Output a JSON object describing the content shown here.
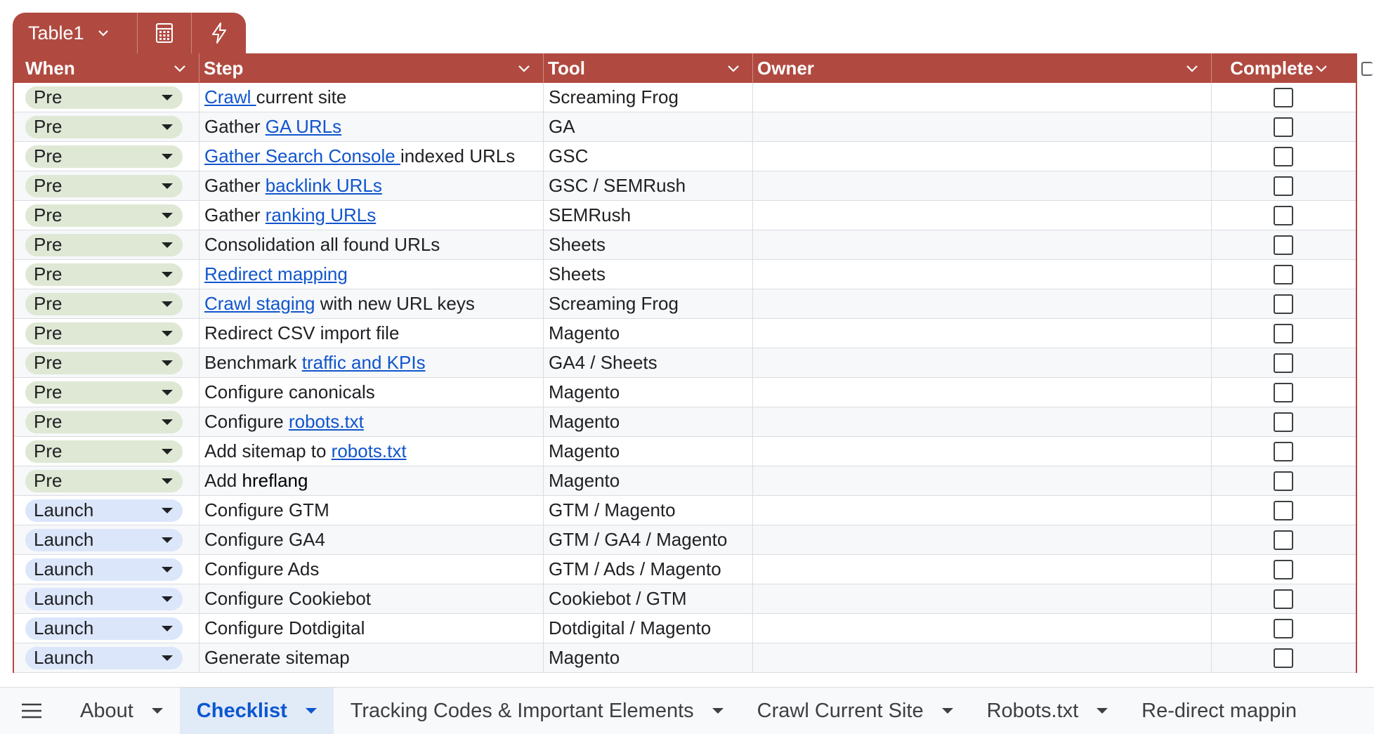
{
  "table": {
    "name": "Table1",
    "columns": [
      "When",
      "Step",
      "Tool",
      "Owner",
      "Complete"
    ],
    "rows": [
      {
        "when": "Pre",
        "step": [
          {
            "t": "Crawl ",
            "l": true
          },
          {
            "t": "current site"
          }
        ],
        "tool": "Screaming Frog"
      },
      {
        "when": "Pre",
        "step": [
          {
            "t": "Gather "
          },
          {
            "t": "GA URLs",
            "l": true
          }
        ],
        "tool": "GA"
      },
      {
        "when": "Pre",
        "step": [
          {
            "t": "Gather Search Console ",
            "l": true
          },
          {
            "t": "indexed URLs"
          }
        ],
        "tool": "GSC"
      },
      {
        "when": "Pre",
        "step": [
          {
            "t": "Gather "
          },
          {
            "t": "backlink URLs",
            "l": true
          }
        ],
        "tool": "GSC / SEMRush"
      },
      {
        "when": "Pre",
        "step": [
          {
            "t": "Gather "
          },
          {
            "t": "ranking URLs",
            "l": true
          }
        ],
        "tool": "SEMRush"
      },
      {
        "when": "Pre",
        "step": [
          {
            "t": "Consolidation all found URLs"
          }
        ],
        "tool": "Sheets"
      },
      {
        "when": "Pre",
        "step": [
          {
            "t": "Redirect mapping",
            "l": true
          }
        ],
        "tool": "Sheets"
      },
      {
        "when": "Pre",
        "step": [
          {
            "t": "Crawl staging",
            "l": true
          },
          {
            "t": " with new URL keys"
          }
        ],
        "tool": "Screaming Frog"
      },
      {
        "when": "Pre",
        "step": [
          {
            "t": "Redirect CSV import file"
          }
        ],
        "tool": "Magento"
      },
      {
        "when": "Pre",
        "step": [
          {
            "t": "Benchmark "
          },
          {
            "t": "traffic and KPIs",
            "l": true
          }
        ],
        "tool": "GA4 / Sheets"
      },
      {
        "when": "Pre",
        "step": [
          {
            "t": "Configure canonicals"
          }
        ],
        "tool": "Magento"
      },
      {
        "when": "Pre",
        "step": [
          {
            "t": "Configure "
          },
          {
            "t": "robots.txt",
            "l": true
          }
        ],
        "tool": "Magento"
      },
      {
        "when": "Pre",
        "step": [
          {
            "t": "Add sitemap to "
          },
          {
            "t": "robots.txt",
            "l": true
          }
        ],
        "tool": "Magento"
      },
      {
        "when": "Pre",
        "step": [
          {
            "t": "Add "
          },
          {
            "t": "hreflang",
            "b": true
          }
        ],
        "tool": "Magento"
      },
      {
        "when": "Launch",
        "step": [
          {
            "t": "Configure GTM"
          }
        ],
        "tool": "GTM / Magento"
      },
      {
        "when": "Launch",
        "step": [
          {
            "t": "Configure GA4"
          }
        ],
        "tool": "GTM / GA4 / Magento"
      },
      {
        "when": "Launch",
        "step": [
          {
            "t": "Configure Ads"
          }
        ],
        "tool": "GTM / Ads / Magento"
      },
      {
        "when": "Launch",
        "step": [
          {
            "t": "Configure Cookiebot"
          }
        ],
        "tool": "Cookiebot / GTM"
      },
      {
        "when": "Launch",
        "step": [
          {
            "t": "Configure Dotdigital"
          }
        ],
        "tool": "Dotdigital / Magento"
      },
      {
        "when": "Launch",
        "step": [
          {
            "t": "Generate sitemap"
          }
        ],
        "tool": "Magento"
      }
    ]
  },
  "sheets": [
    "About",
    "Checklist",
    "Tracking Codes & Important Elements",
    "Crawl Current Site",
    "Robots.txt",
    "Re-direct mappin"
  ],
  "active_sheet": "Checklist",
  "colors": {
    "header": "#b04a40",
    "pre_chip": "#dfe8d4",
    "launch_chip": "#dbe6fa",
    "link": "#1155cc",
    "active_tab": "#0b57d0"
  }
}
